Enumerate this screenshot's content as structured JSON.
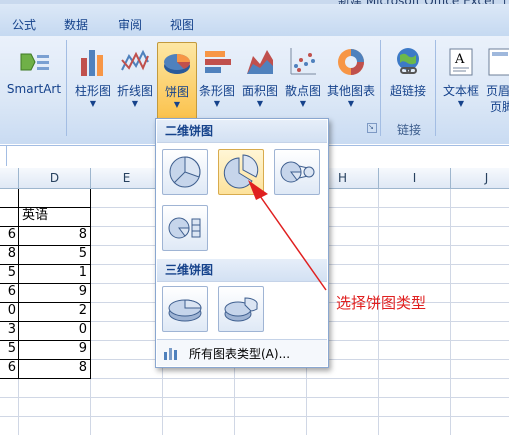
{
  "window": {
    "title": "新建 Microsoft Office Excel 工"
  },
  "tabs": [
    "公式",
    "数据",
    "审阅",
    "视图"
  ],
  "ribbon": {
    "smartart": "SmartArt",
    "charts": [
      "柱形图",
      "折线图",
      "饼图",
      "条形图",
      "面积图",
      "散点图",
      "其他图表"
    ],
    "hyperlink": "超链接",
    "textbox": "文本框",
    "header_footer_top": "页眉",
    "header_footer_bottom": "页脚",
    "group_link": "链接"
  },
  "columns": [
    "D",
    "E",
    "F",
    "G",
    "H",
    "I",
    "J"
  ],
  "grid": {
    "header_cell": "英语",
    "left_values": [
      "6",
      "8",
      "5",
      "6",
      "0",
      "3",
      "5",
      "6"
    ],
    "d_values": [
      "8",
      "5",
      "1",
      "9",
      "2",
      "0",
      "9",
      "8"
    ]
  },
  "dropdown": {
    "section_2d": "二维饼图",
    "section_3d": "三维饼图",
    "footer": "所有图表类型(A)..."
  },
  "annotation": {
    "text": "选择饼图类型",
    "color": "#e02020"
  },
  "colors": {
    "ribbon_text": "#15428b",
    "selected_button": "#fbc24c",
    "accent": "#4f81bd"
  }
}
